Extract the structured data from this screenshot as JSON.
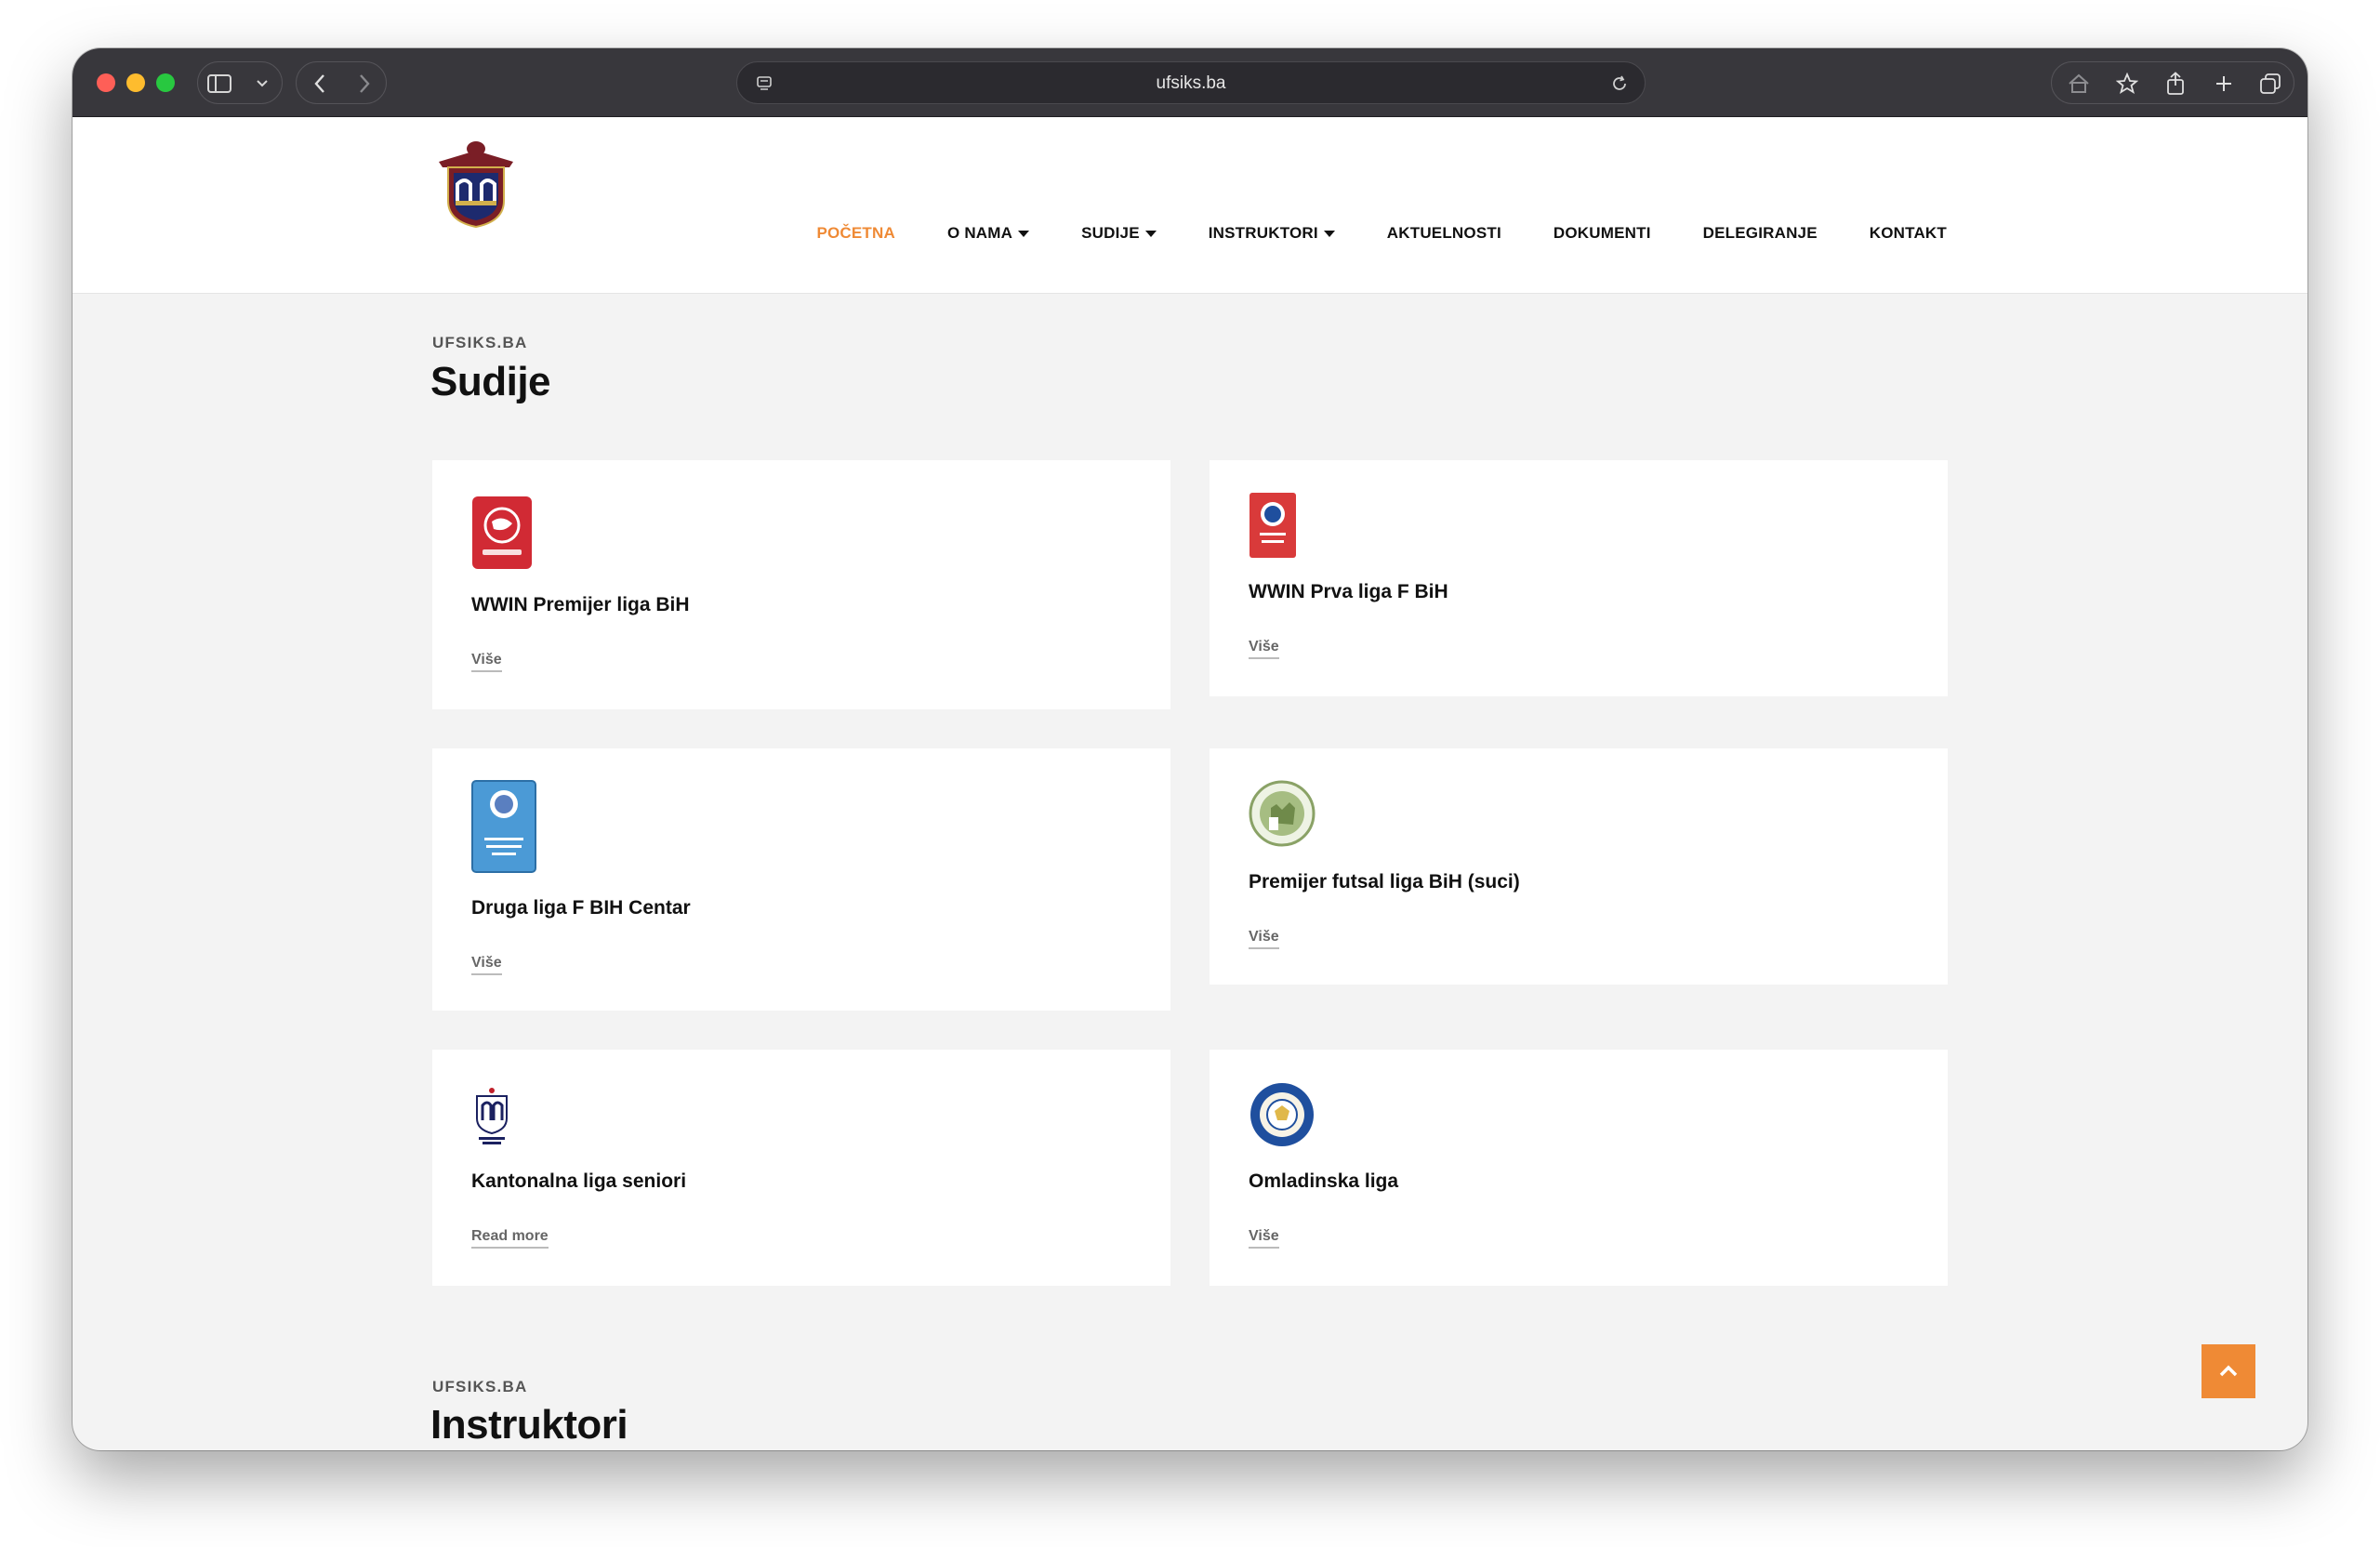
{
  "browser": {
    "url": "ufsiks.ba"
  },
  "nav": {
    "items": [
      {
        "label": "POČETNA",
        "active": true,
        "dropdown": false
      },
      {
        "label": "O NAMA",
        "active": false,
        "dropdown": true
      },
      {
        "label": "SUDIJE",
        "active": false,
        "dropdown": true
      },
      {
        "label": "INSTRUKTORI",
        "active": false,
        "dropdown": true
      },
      {
        "label": "AKTUELNOSTI",
        "active": false,
        "dropdown": false
      },
      {
        "label": "DOKUMENTI",
        "active": false,
        "dropdown": false
      },
      {
        "label": "DELEGIRANJE",
        "active": false,
        "dropdown": false
      },
      {
        "label": "KONTAKT",
        "active": false,
        "dropdown": false
      }
    ]
  },
  "sudije": {
    "eyebrow": "UFSIKS.BA",
    "title": "Sudije",
    "cards": [
      {
        "title": "WWIN Premijer liga BiH",
        "link": "Više",
        "icon": "wwin-liga-logo-icon"
      },
      {
        "title": "WWIN Prva liga F BiH",
        "link": "Više",
        "icon": "prva-liga-fbih-logo-icon"
      },
      {
        "title": "Druga liga F BIH Centar",
        "link": "Više",
        "icon": "druga-liga-logo-icon"
      },
      {
        "title": "Premijer futsal liga BiH (suci)",
        "link": "Više",
        "icon": "futsal-liga-logo-icon"
      },
      {
        "title": "Kantonalna liga seniori",
        "link": "Read more",
        "icon": "kantonalna-liga-logo-icon"
      },
      {
        "title": "Omladinska liga",
        "link": "Više",
        "icon": "omladinska-liga-logo-icon"
      }
    ]
  },
  "instruktori": {
    "eyebrow": "UFSIKS.BA",
    "title": "Instruktori"
  },
  "colors": {
    "accent": "#ef8a35",
    "page_bg": "#f3f3f3",
    "chrome_bg": "#38373c"
  }
}
